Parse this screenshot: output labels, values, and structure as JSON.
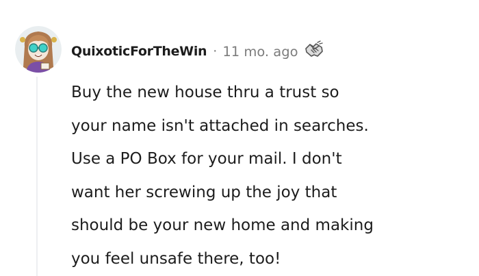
{
  "comment": {
    "username": "QuixoticForTheWin",
    "separator": "·",
    "timestamp": "11 mo. ago",
    "avatar_icon": "user-avatar-cartoon-icon",
    "award_icon": "handshake-award-icon",
    "body_lines": [
      "Buy the new house thru a trust so",
      "your name isn't attached in searches.",
      "Use a PO Box for your mail. I don't",
      "want her screwing up the joy that",
      "should be your new home and making",
      "you feel unsafe there, too!"
    ]
  },
  "colors": {
    "text": "#1c1c1c",
    "meta": "#7c7c7c",
    "thread_line": "#edeff1",
    "avatar_bg": "#e9eef0"
  }
}
